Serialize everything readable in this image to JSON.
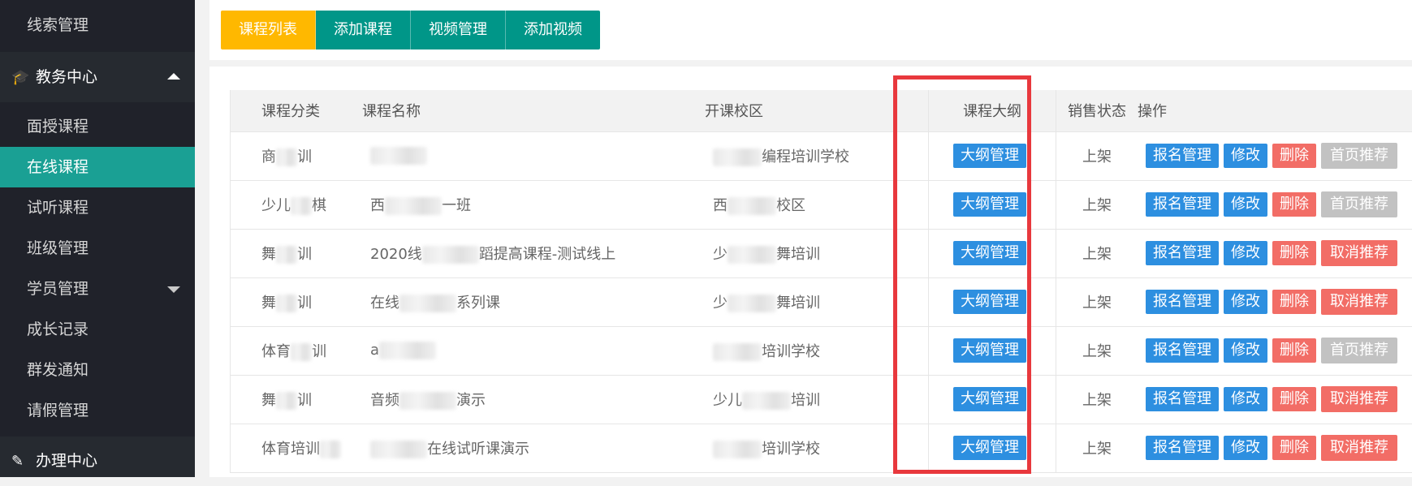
{
  "sidebar": {
    "items_top": [
      {
        "label": "线索管理"
      }
    ],
    "group_edu": {
      "icon": "graduation-cap-icon",
      "label": "教务中心"
    },
    "items": [
      {
        "label": "面授课程",
        "active": false
      },
      {
        "label": "在线课程",
        "active": true
      },
      {
        "label": "试听课程",
        "active": false
      },
      {
        "label": "班级管理",
        "active": false
      },
      {
        "label": "学员管理",
        "active": false,
        "has_dropdown": true
      },
      {
        "label": "成长记录",
        "active": false
      },
      {
        "label": "群发通知",
        "active": false
      },
      {
        "label": "请假管理",
        "active": false
      }
    ],
    "group_office": {
      "icon": "edit-icon",
      "label": "办理中心"
    }
  },
  "tabs": [
    {
      "label": "课程列表",
      "active": true
    },
    {
      "label": "添加课程",
      "active": false
    },
    {
      "label": "视频管理",
      "active": false
    },
    {
      "label": "添加视频",
      "active": false
    }
  ],
  "table": {
    "headers": {
      "category": "课程分类",
      "name": "课程名称",
      "campus": "开课校区",
      "outline": "课程大纲",
      "status": "销售状态",
      "ops": "操作"
    },
    "rows": [
      {
        "category_a": "商",
        "category_b": "训",
        "name_a": "",
        "name_b": "",
        "campus_a": "",
        "campus_b": "编程培训学校",
        "outline_btn": "大纲管理",
        "status": "上架",
        "enroll_btn": "报名管理",
        "edit_btn": "修改",
        "delete_btn": "删除",
        "recommend_btn": "首页推荐",
        "recommend_state": "gray"
      },
      {
        "category_a": "少儿",
        "category_b": "棋",
        "name_a": "西",
        "name_b": "一班",
        "campus_a": "西",
        "campus_b": "校区",
        "outline_btn": "大纲管理",
        "status": "上架",
        "enroll_btn": "报名管理",
        "edit_btn": "修改",
        "delete_btn": "删除",
        "recommend_btn": "首页推荐",
        "recommend_state": "gray"
      },
      {
        "category_a": "舞",
        "category_b": "训",
        "name_a": "2020线",
        "name_b": "蹈提高课程-测试线上",
        "campus_a": "少",
        "campus_b": "舞培训",
        "outline_btn": "大纲管理",
        "status": "上架",
        "enroll_btn": "报名管理",
        "edit_btn": "修改",
        "delete_btn": "删除",
        "recommend_btn": "取消推荐",
        "recommend_state": "coral"
      },
      {
        "category_a": "舞",
        "category_b": "训",
        "name_a": "在线",
        "name_b": "系列课",
        "campus_a": "少",
        "campus_b": "舞培训",
        "outline_btn": "大纲管理",
        "status": "上架",
        "enroll_btn": "报名管理",
        "edit_btn": "修改",
        "delete_btn": "删除",
        "recommend_btn": "取消推荐",
        "recommend_state": "coral"
      },
      {
        "category_a": "体育",
        "category_b": "训",
        "name_a": "a",
        "name_b": "",
        "campus_a": "",
        "campus_b": "培训学校",
        "outline_btn": "大纲管理",
        "status": "上架",
        "enroll_btn": "报名管理",
        "edit_btn": "修改",
        "delete_btn": "删除",
        "recommend_btn": "首页推荐",
        "recommend_state": "gray"
      },
      {
        "category_a": "舞",
        "category_b": "训",
        "name_a": "音频",
        "name_b": "演示",
        "campus_a": "少儿",
        "campus_b": "培训",
        "outline_btn": "大纲管理",
        "status": "上架",
        "enroll_btn": "报名管理",
        "edit_btn": "修改",
        "delete_btn": "删除",
        "recommend_btn": "取消推荐",
        "recommend_state": "coral"
      },
      {
        "category_a": "体育培训",
        "category_b": "",
        "name_a": "",
        "name_b": "在线试听课演示",
        "campus_a": "",
        "campus_b": "培训学校",
        "outline_btn": "大纲管理",
        "status": "上架",
        "enroll_btn": "报名管理",
        "edit_btn": "修改",
        "delete_btn": "删除",
        "recommend_btn": "取消推荐",
        "recommend_state": "coral"
      }
    ]
  },
  "colors": {
    "sidebar_bg": "#20222a",
    "active_green": "#1aa094",
    "tab_green": "#009688",
    "tab_active": "#ffb800",
    "btn_blue": "#2d8fe0",
    "btn_red": "#f26d66",
    "btn_gray": "#c2c2c2",
    "highlight_red": "#e8383d"
  }
}
